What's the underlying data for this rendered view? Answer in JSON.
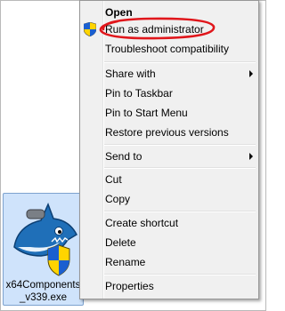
{
  "desktop": {
    "file_name": "x64Components_v339.exe"
  },
  "context_menu": {
    "items": {
      "open": "Open",
      "run_as_admin": "Run as administrator",
      "troubleshoot": "Troubleshoot compatibility",
      "share_with": "Share with",
      "pin_taskbar": "Pin to Taskbar",
      "pin_start": "Pin to Start Menu",
      "restore": "Restore previous versions",
      "send_to": "Send to",
      "cut": "Cut",
      "copy": "Copy",
      "create_shortcut": "Create shortcut",
      "delete": "Delete",
      "rename": "Rename",
      "properties": "Properties"
    }
  },
  "annotation": {
    "highlight_color": "#e0161b"
  },
  "icons": [
    "uac-shield-icon",
    "submenu-arrow-icon",
    "shark-app-icon"
  ]
}
